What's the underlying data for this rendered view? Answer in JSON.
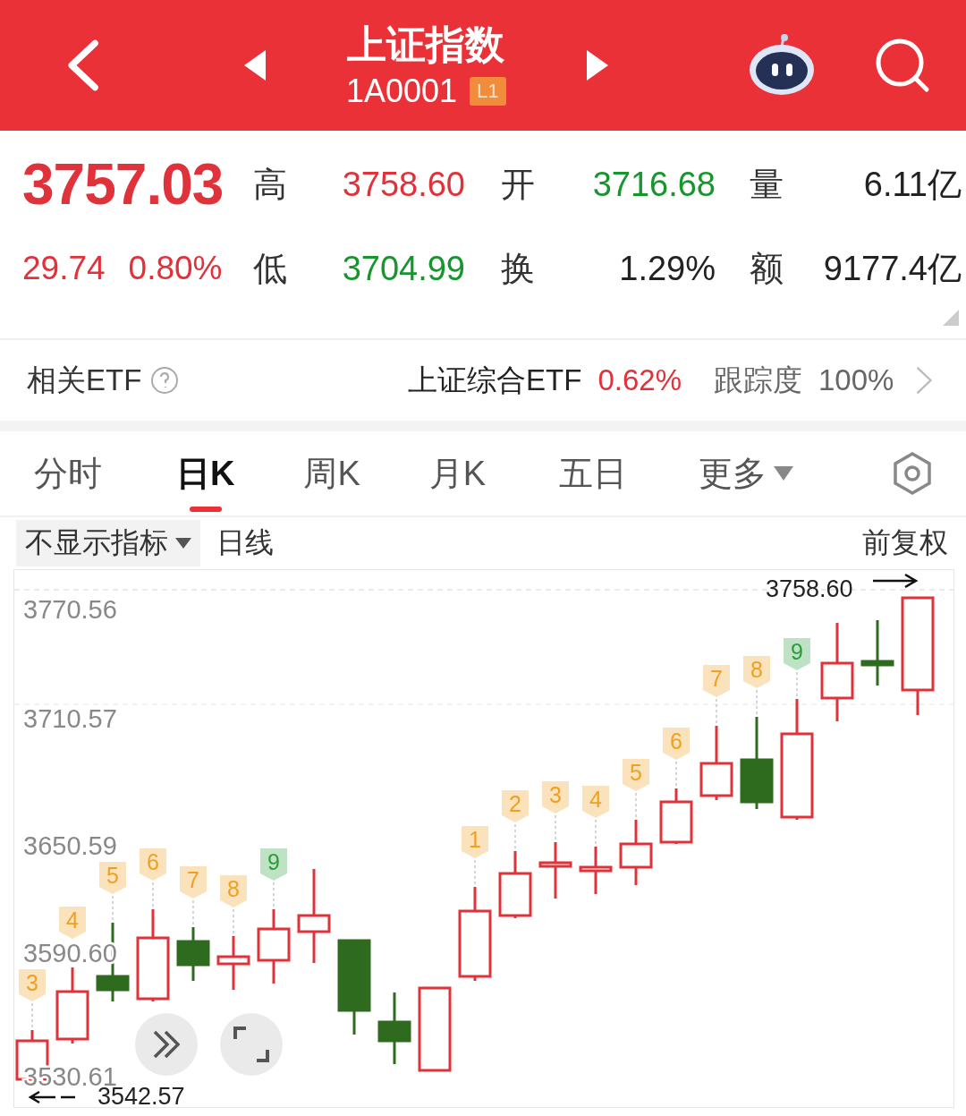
{
  "header": {
    "title": "上证指数",
    "code": "1A0001",
    "badge": "L1"
  },
  "quote": {
    "price": "3757.03",
    "change": "29.74",
    "change_pct": "0.80%",
    "color": "#e0323a",
    "fields": [
      {
        "label": "高",
        "value": "3758.60",
        "color": "#e0323a"
      },
      {
        "label": "开",
        "value": "3716.68",
        "color": "#17962e"
      },
      {
        "label": "量",
        "value": "6.11亿",
        "color": "#222222"
      },
      {
        "label": "低",
        "value": "3704.99",
        "color": "#17962e"
      },
      {
        "label": "换",
        "value": "1.29%",
        "color": "#222222"
      },
      {
        "label": "额",
        "value": "9177.4亿",
        "color": "#222222"
      }
    ]
  },
  "etf": {
    "label": "相关ETF",
    "name": "上证综合ETF",
    "change": "0.62%",
    "tracking_label": "跟踪度",
    "tracking": "100%"
  },
  "tabs": [
    {
      "label": "分时",
      "selected": false
    },
    {
      "label": "日K",
      "selected": true
    },
    {
      "label": "周K",
      "selected": false
    },
    {
      "label": "月K",
      "selected": false
    },
    {
      "label": "五日",
      "selected": false
    },
    {
      "label": "更多",
      "selected": false,
      "kind": "dropdown"
    }
  ],
  "toolbar": {
    "indicator": "不显示指标",
    "period": "日线",
    "adjust": "前复权"
  },
  "chart": {
    "axis_labels": [
      "3770.56",
      "3710.57",
      "3650.59",
      "3590.60",
      "3530.61"
    ],
    "high_label": "3758.60",
    "low_label": "3542.57",
    "sequence_markers": [
      {
        "label": "3",
        "color": "#f0a020"
      },
      {
        "label": "4",
        "color": "#f0a020"
      },
      {
        "label": "5",
        "color": "#f0a020"
      },
      {
        "label": "6",
        "color": "#f0a020"
      },
      {
        "label": "7",
        "color": "#f0a020"
      },
      {
        "label": "8",
        "color": "#f0a020"
      },
      {
        "label": "9",
        "color": "#2a9d3a"
      },
      {
        "label": "1",
        "color": "#f0a020"
      },
      {
        "label": "2",
        "color": "#f0a020"
      },
      {
        "label": "3",
        "color": "#f0a020"
      },
      {
        "label": "4",
        "color": "#f0a020"
      },
      {
        "label": "5",
        "color": "#f0a020"
      },
      {
        "label": "6",
        "color": "#f0a020"
      },
      {
        "label": "7",
        "color": "#f0a020"
      },
      {
        "label": "8",
        "color": "#f0a020"
      },
      {
        "label": "9",
        "color": "#2a9d3a"
      }
    ]
  }
}
